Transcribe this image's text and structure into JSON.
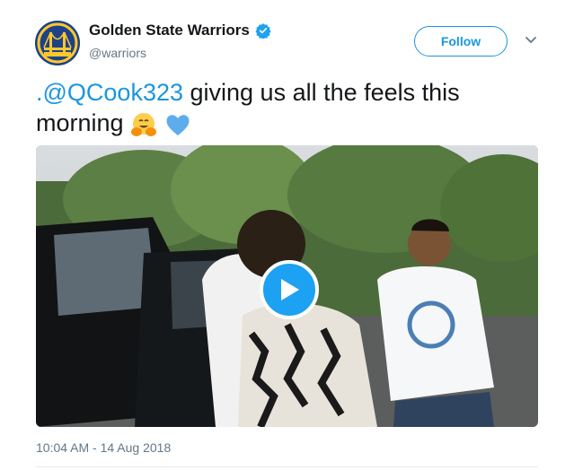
{
  "account": {
    "display_name": "Golden State Warriors",
    "handle": "@warriors",
    "verified": true,
    "avatar_icon": "warriors-bridge-logo",
    "brand_colors": {
      "primary": "#1d428a",
      "secondary": "#ffc72c"
    }
  },
  "follow_button": {
    "label": "Follow",
    "color": "#1b95e0"
  },
  "tweet": {
    "mention": ".@QCook323",
    "text_line1": " giving us all the feels this",
    "text_line2": "morning ",
    "emojis": [
      "hugging-face-emoji",
      "blue-heart-emoji"
    ]
  },
  "media": {
    "type": "video",
    "play_icon": "play-icon",
    "accent": "#1da1f2"
  },
  "footer": {
    "timestamp": "10:04 AM - 14 Aug 2018"
  }
}
